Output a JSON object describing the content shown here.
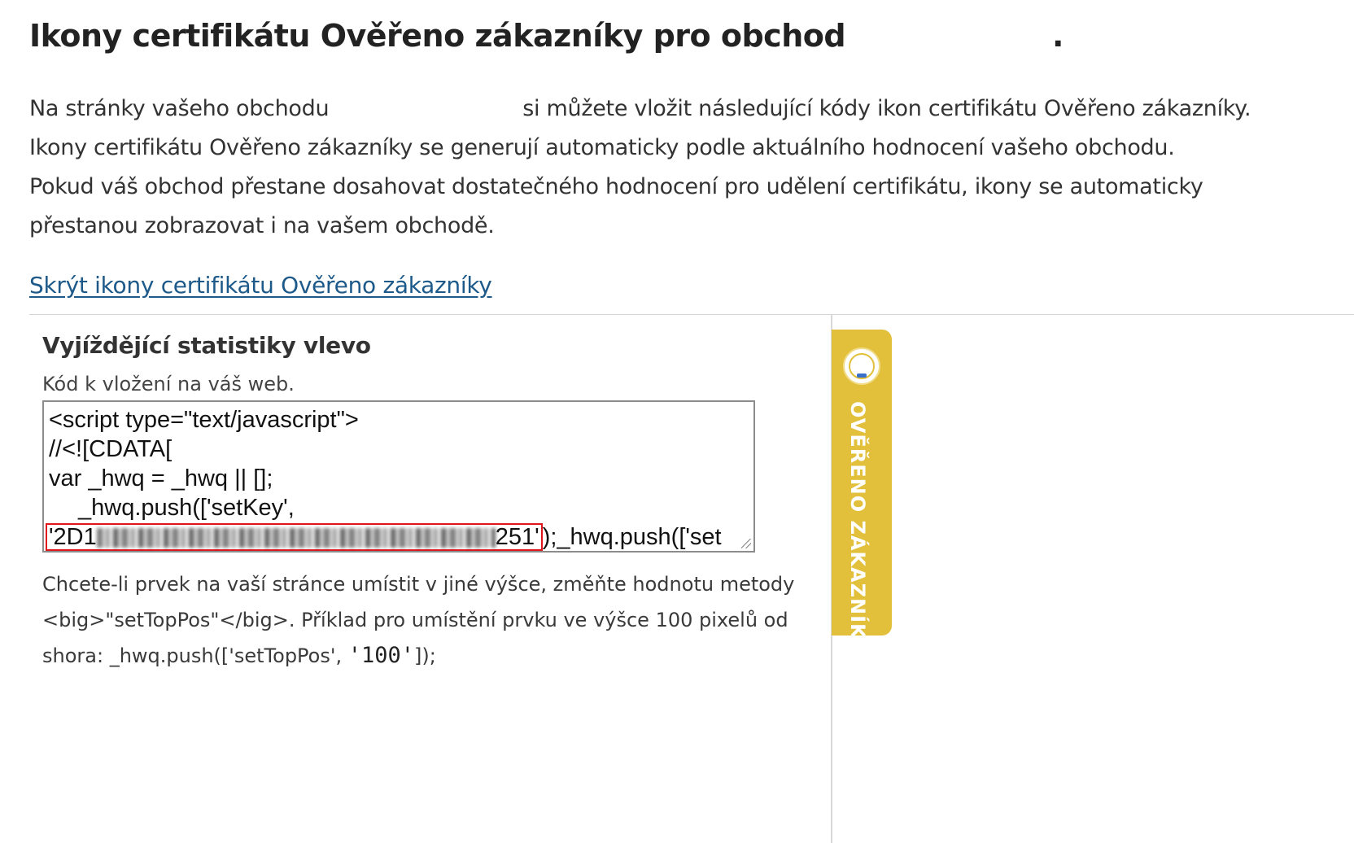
{
  "page": {
    "title": "Ikony certifikátu Ověřeno zákazníky pro obchod",
    "title_end": "."
  },
  "intro": {
    "line1_start": "Na stránky vašeho obchodu",
    "line1_end": "si můžete vložit následující kódy ikon certifikátu Ověřeno zákazníky.",
    "line2": "Ikony certifikátu Ověřeno zákazníky se generují automaticky podle aktuálního hodnocení vašeho obchodu.",
    "line3": "Pokud váš obchod přestane dosahovat dostatečného hodnocení pro udělení certifikátu, ikony se automaticky",
    "line4": "přestanou zobrazovat i na vašem obchodě."
  },
  "toggle_link": "Skrýt ikony certifikátu Ověřeno zákazníky",
  "widget": {
    "title": "Vyjíždějící statistiky vlevo",
    "subtitle": "Kód k vložení na váš web.",
    "code": {
      "line1": "<script type=\"text/javascript\">",
      "line2": "//<![CDATA[",
      "line3": "var _hwq = _hwq || [];",
      "line4": "_hwq.push(['setKey',",
      "key_start": "'2D1",
      "key_end": "251'",
      "line5_rest": ");_hwq.push(['set"
    },
    "help": {
      "line1": "Chcete-li prvek na vaší stránce umístit v jiné výšce, změňte hodnotu metody",
      "line2": "<big>\"setTopPos\"</big>. Příklad pro umístění prvku ve výšce 100 pixelů od",
      "line3_start": "shora: _hwq.push(['setTopPos', ",
      "line3_value": "'100'",
      "line3_end": "]);"
    }
  },
  "badge": {
    "text": "OVĚŘENO ZÁKAZNÍKY",
    "color": "#e2c03c",
    "icon": "overeno-zakazniky-seal-icon"
  },
  "colors": {
    "link": "#1d5a8a",
    "highlight_border": "#e0141b"
  }
}
